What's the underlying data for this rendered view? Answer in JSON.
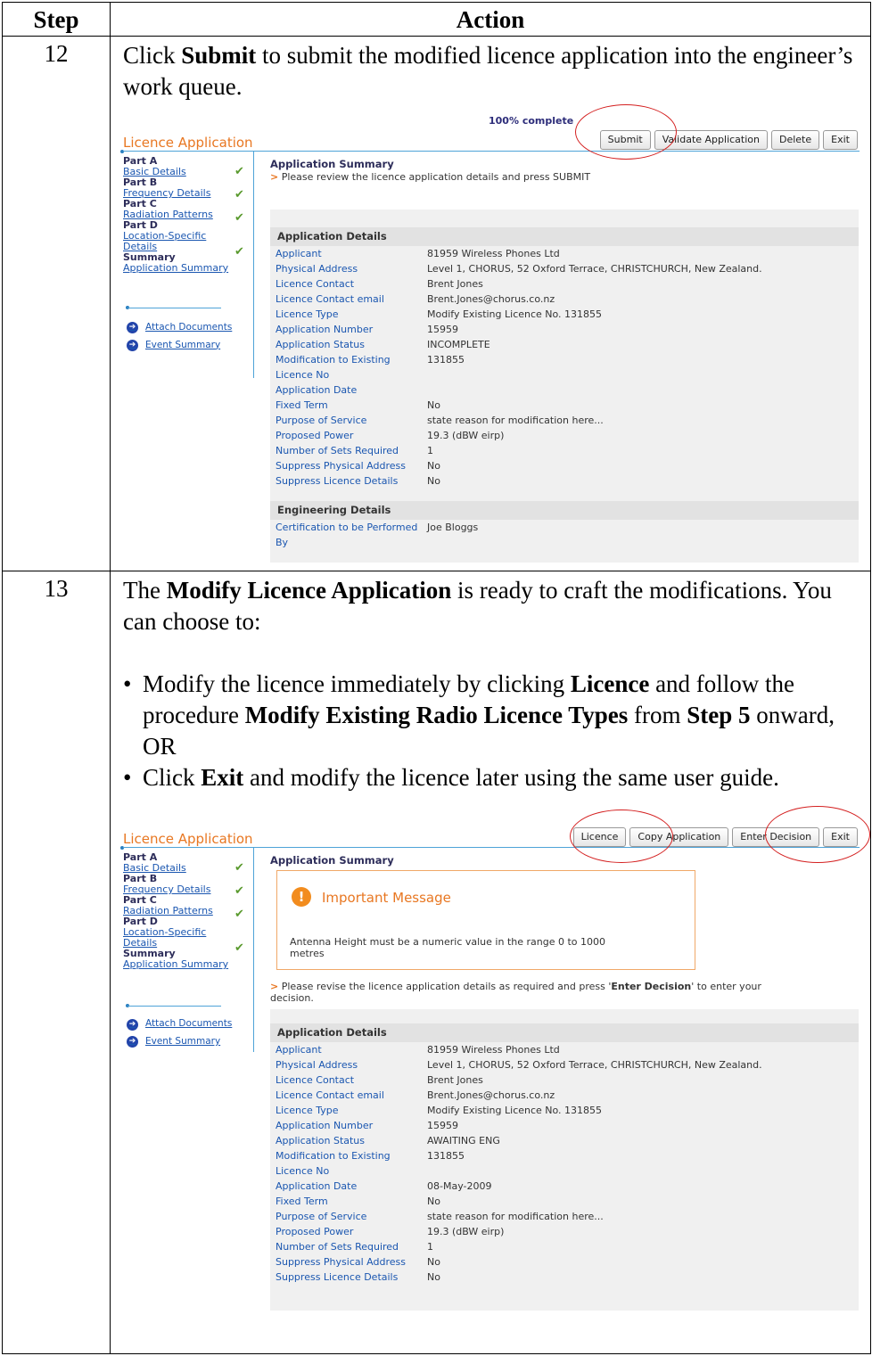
{
  "table": {
    "col_step": "Step",
    "col_action": "Action"
  },
  "step12": {
    "number": "12",
    "text_pre": "Click ",
    "text_bold": "Submit",
    "text_post": " to submit the modified licence application into the engineer’s work queue.",
    "screen": {
      "faded_status": "100% complete",
      "title": "Licence Application",
      "buttons": [
        "Submit",
        "Validate Application",
        "Delete",
        "Exit"
      ],
      "sidebar": [
        {
          "part": "Part A",
          "link": "Basic Details"
        },
        {
          "part": "Part B",
          "link": "Frequency Details"
        },
        {
          "part": "Part C",
          "link": "Radiation Patterns"
        },
        {
          "part": "Part D",
          "link": "Location-Specific Details"
        },
        {
          "part": "Summary",
          "link": "Application Summary"
        }
      ],
      "nav": [
        "Attach Documents",
        "Event Summary"
      ],
      "summary_title": "Application Summary",
      "summary_text": "Please review the licence application details and press SUBMIT",
      "details_title": "Application Details",
      "details": [
        {
          "k": "Applicant",
          "v": "81959 Wireless Phones Ltd"
        },
        {
          "k": "Physical Address",
          "v": "Level 1, CHORUS, 52 Oxford Terrace, CHRISTCHURCH, New Zealand."
        },
        {
          "k": "Licence Contact",
          "v": "Brent Jones"
        },
        {
          "k": "Licence Contact email",
          "v": "Brent.Jones@chorus.co.nz"
        },
        {
          "k": "Licence Type",
          "v": "Modify Existing Licence No. 131855"
        },
        {
          "k": "Application Number",
          "v": "15959"
        },
        {
          "k": "Application Status",
          "v": "INCOMPLETE"
        },
        {
          "k": "Modification to Existing Licence No",
          "v": "131855"
        },
        {
          "k": "Application Date",
          "v": ""
        },
        {
          "k": "Fixed Term",
          "v": "No"
        },
        {
          "k": "Purpose of Service",
          "v": "state reason for modification here..."
        },
        {
          "k": "Proposed Power",
          "v": "19.3 (dBW eirp)"
        },
        {
          "k": "Number of Sets Required",
          "v": "1"
        },
        {
          "k": "Suppress Physical Address",
          "v": "No"
        },
        {
          "k": "Suppress Licence Details",
          "v": "No"
        }
      ],
      "eng_title": "Engineering Details",
      "eng_key": "Certification to be Performed By",
      "eng_val": "Joe Bloggs"
    }
  },
  "step13": {
    "number": "13",
    "intro_pre": "The ",
    "intro_bold": "Modify Licence Application",
    "intro_post": " is ready to craft the modifications.  You can choose to:",
    "b1_pre": "Modify the licence immediately by clicking ",
    "b1_bold1": "Licence",
    "b1_mid": " and follow the procedure ",
    "b1_bold2": "Modify Existing Radio Licence Types",
    "b1_mid2": " from ",
    "b1_bold3": "Step 5",
    "b1_post": " onward, OR",
    "b2_pre": "Click ",
    "b2_bold": "Exit",
    "b2_post": " and modify the licence later using the same user guide.",
    "screen": {
      "title": "Licence Application",
      "buttons": [
        "Licence",
        "Copy Application",
        "Enter Decision",
        "Exit"
      ],
      "summary_title": "Application Summary",
      "msg_title": "Important Message",
      "msg_body": "Antenna Height must be a numeric value in the range 0 to 1000 metres",
      "revise_pre": "Please revise the licence application details as required and press '",
      "revise_bold": "Enter Decision",
      "revise_post": "' to enter your decision.",
      "details_title": "Application Details",
      "details": [
        {
          "k": "Applicant",
          "v": "81959 Wireless Phones Ltd"
        },
        {
          "k": "Physical Address",
          "v": "Level 1, CHORUS, 52 Oxford Terrace, CHRISTCHURCH, New Zealand."
        },
        {
          "k": "Licence Contact",
          "v": "Brent Jones"
        },
        {
          "k": "Licence Contact email",
          "v": "Brent.Jones@chorus.co.nz"
        },
        {
          "k": "Licence Type",
          "v": "Modify Existing Licence No. 131855"
        },
        {
          "k": "Application Number",
          "v": "15959"
        },
        {
          "k": "Application Status",
          "v": "AWAITING ENG"
        },
        {
          "k": "Modification to Existing Licence No",
          "v": "131855"
        },
        {
          "k": "Application Date",
          "v": "08-May-2009"
        },
        {
          "k": "Fixed Term",
          "v": "No"
        },
        {
          "k": "Purpose of Service",
          "v": "state reason for modification here..."
        },
        {
          "k": "Proposed Power",
          "v": "19.3 (dBW eirp)"
        },
        {
          "k": "Number of Sets Required",
          "v": "1"
        },
        {
          "k": "Suppress Physical Address",
          "v": "No"
        },
        {
          "k": "Suppress Licence Details",
          "v": "No"
        }
      ]
    }
  }
}
